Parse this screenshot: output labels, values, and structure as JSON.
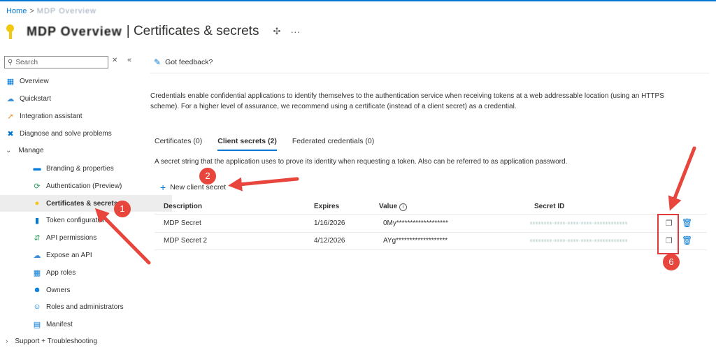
{
  "breadcrumb": {
    "home": "Home",
    "current": "MDP Overview"
  },
  "header": {
    "app_name": "MDP Overview",
    "title": "| Certificates & secrets",
    "pin": "✣",
    "more": "···"
  },
  "sidebar": {
    "search_placeholder": "Search",
    "close": "✕",
    "collapse": "«",
    "items": [
      {
        "label": "Overview",
        "icon": "grid-icon"
      },
      {
        "label": "Quickstart",
        "icon": "cloud-icon"
      },
      {
        "label": "Integration assistant",
        "icon": "rocket-icon"
      },
      {
        "label": "Diagnose and solve problems",
        "icon": "wrench-icon"
      },
      {
        "label": "Manage",
        "icon": "chevron-down-icon"
      },
      {
        "label": "Branding & properties",
        "icon": "branding-icon"
      },
      {
        "label": "Authentication (Preview)",
        "icon": "auth-icon"
      },
      {
        "label": "Certificates & secrets",
        "icon": "key-icon"
      },
      {
        "label": "Token configuration",
        "icon": "token-icon"
      },
      {
        "label": "API permissions",
        "icon": "api-permissions-icon"
      },
      {
        "label": "Expose an API",
        "icon": "cloud-icon"
      },
      {
        "label": "App roles",
        "icon": "app-roles-icon"
      },
      {
        "label": "Owners",
        "icon": "owners-icon"
      },
      {
        "label": "Roles and administrators",
        "icon": "roles-icon"
      },
      {
        "label": "Manifest",
        "icon": "manifest-icon"
      },
      {
        "label": "Support + Troubleshooting",
        "icon": "chevron-right-icon"
      }
    ]
  },
  "main": {
    "feedback": "Got feedback?",
    "description": "Credentials enable confidential applications to identify themselves to the authentication service when receiving tokens at a web addressable location (using an HTTPS scheme). For a higher level of assurance, we recommend using a certificate (instead of a client secret) as a credential.",
    "tabs": [
      {
        "label": "Certificates (0)"
      },
      {
        "label": "Client secrets (2)"
      },
      {
        "label": "Federated credentials (0)"
      }
    ],
    "secret_description": "A secret string that the application uses to prove its identity when requesting a token. Also can be referred to as application password.",
    "new_secret": "New client secret",
    "columns": [
      "Description",
      "Expires",
      "Value",
      "Secret ID"
    ],
    "rows": [
      {
        "description": "MDP Secret",
        "expires": "1/16/2026",
        "value": "0My*******************",
        "secret_id": "xxxxxxxx-xxxx-xxxx-xxxx-xxxxxxxxxxxx"
      },
      {
        "description": "MDP Secret 2",
        "expires": "4/12/2026",
        "value": "AYg*******************",
        "secret_id": "xxxxxxxx-xxxx-xxxx-xxxx-xxxxxxxxxxxx"
      }
    ]
  },
  "annotations": {
    "badge1": "1",
    "badge2": "2",
    "badge6": "6"
  },
  "colors": {
    "accent": "#0078d4",
    "annotation": "#e8453c",
    "key": "#f2c811"
  }
}
